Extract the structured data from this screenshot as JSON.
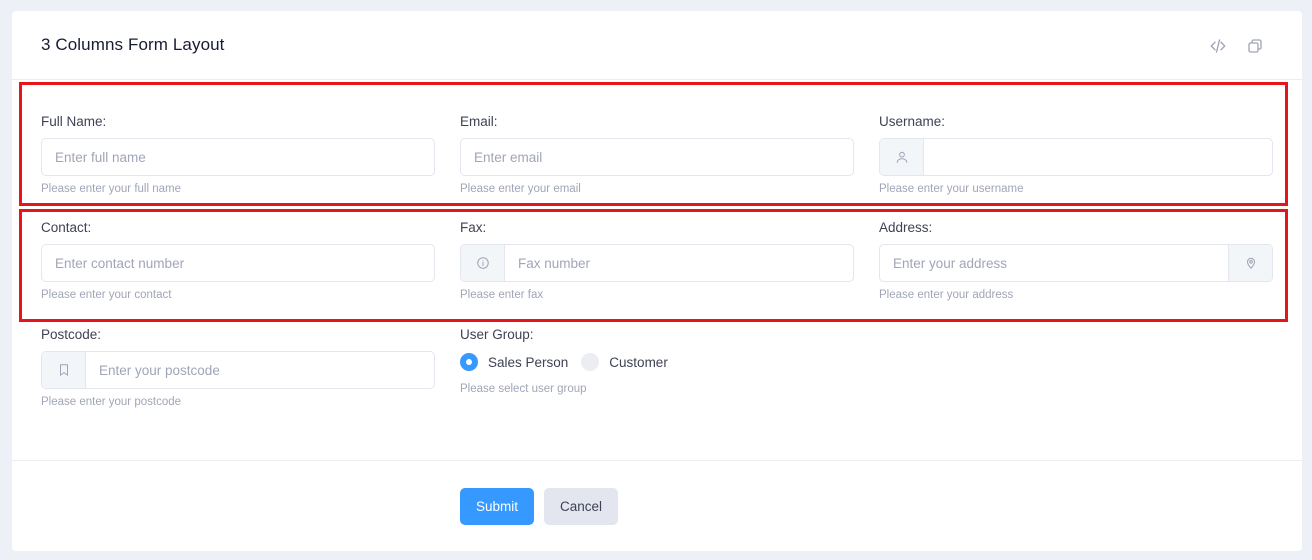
{
  "card": {
    "title": "3 Columns Form Layout",
    "icons": {
      "code": "code-icon",
      "copy": "copy-icon"
    }
  },
  "form": {
    "full_name": {
      "label": "Full Name:",
      "placeholder": "Enter full name",
      "help": "Please enter your full name"
    },
    "email": {
      "label": "Email:",
      "placeholder": "Enter email",
      "help": "Please enter your email"
    },
    "username": {
      "label": "Username:",
      "placeholder": "",
      "help": "Please enter your username",
      "icon": "user-icon"
    },
    "contact": {
      "label": "Contact:",
      "placeholder": "Enter contact number",
      "help": "Please enter your contact"
    },
    "fax": {
      "label": "Fax:",
      "placeholder": "Fax number",
      "help": "Please enter fax",
      "icon": "info-circle-icon"
    },
    "address": {
      "label": "Address:",
      "placeholder": "Enter your address",
      "help": "Please enter your address",
      "icon": "map-pin-icon"
    },
    "postcode": {
      "label": "Postcode:",
      "placeholder": "Enter your postcode",
      "help": "Please enter your postcode",
      "icon": "bookmark-icon"
    },
    "user_group": {
      "label": "User Group:",
      "options": [
        {
          "label": "Sales Person",
          "checked": true
        },
        {
          "label": "Customer",
          "checked": false
        }
      ],
      "help": "Please select user group"
    }
  },
  "footer": {
    "submit_label": "Submit",
    "cancel_label": "Cancel"
  },
  "colors": {
    "primary": "#3699ff",
    "highlight": "#e8141b",
    "background": "#eef0f8"
  }
}
